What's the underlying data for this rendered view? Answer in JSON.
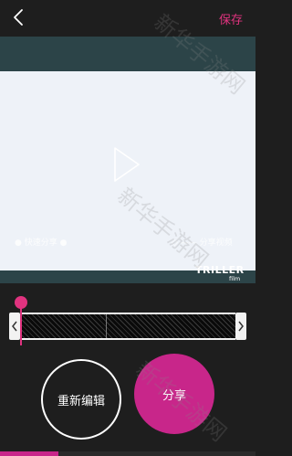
{
  "header": {
    "save_label": "保存"
  },
  "video": {
    "caption_left": "● 快速分享 ●",
    "caption_right": "◇ —— 分享视频",
    "brand_name": "TRILLER",
    "brand_sub": "film"
  },
  "timeline": {
    "playhead_position_fraction": 0.0
  },
  "actions": {
    "reedit_label": "重新编辑",
    "share_label": "分享"
  },
  "watermarks": {
    "text_1": "新华手游网",
    "text_2": "新华手游网",
    "text_3": "新华手游网"
  },
  "bottom": {
    "progress_fraction": 0.23
  },
  "colors": {
    "accent": "#e0337f",
    "share_button": "#c8268a",
    "video_frame": "#2c4448",
    "background": "#1e1e1e"
  }
}
